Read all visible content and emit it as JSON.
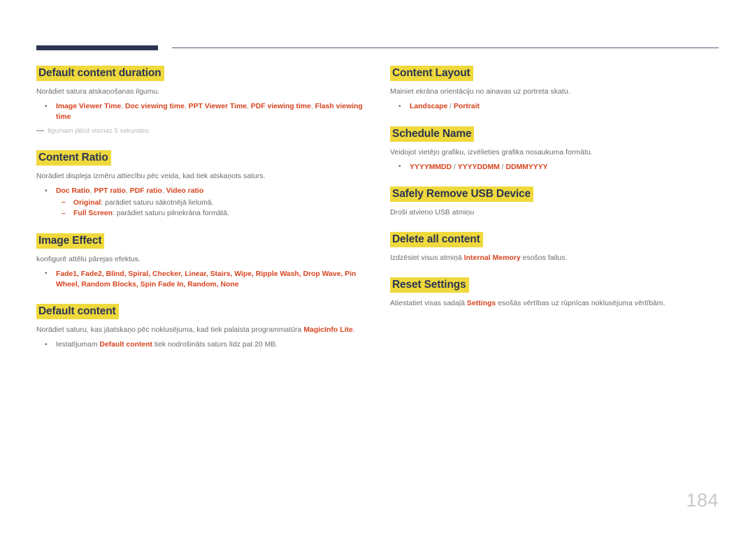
{
  "page": {
    "number": "184",
    "accent_color": "#d8431f",
    "heading_color": "#2c3553",
    "highlight_color": "#efd93c",
    "body_color": "#6b6b6b",
    "note_color": "#b9b9b9"
  },
  "left_column": {
    "sections": [
      {
        "heading": "Default content duration",
        "body": "Norādiet satura atskaņošanas ilgumu.",
        "bullet": {
          "a": "Image Viewer Time",
          "c1": ", ",
          "b": "Doc viewing time",
          "c2": ", ",
          "c": "PPT Viewer Time",
          "c3": ", ",
          "d": "PDF viewing time",
          "c4": ", ",
          "e": "Flash viewing time"
        },
        "note": "Ilgumam jābūt vismaz 5 sekundes."
      },
      {
        "heading": "Content Ratio",
        "body": "Norādiet displeja izmēru attiecību pēc veida, kad tiek atskaņots saturs.",
        "bullet": {
          "a": "Doc Ratio",
          "c1": ", ",
          "b": "PPT ratio",
          "c2": ", ",
          "c": "PDF ratio",
          "c3": ", ",
          "d": "Video ratio"
        },
        "sub": [
          {
            "term": "Original",
            "text": ": parādiet saturu sākotnējā lielumā."
          },
          {
            "term": "Full Screen",
            "text": ": parādiet saturu pilnekrāna formātā."
          }
        ]
      },
      {
        "heading": "Image Effect",
        "body": "konfigurē attēlu pārejas efektus.",
        "effects_line": "Fade1, Fade2, Blind, Spiral, Checker, Linear, Stairs, Wipe, Ripple Wash, Drop Wave, Pin Wheel, Random Blocks, Spin Fade In, Random, None"
      },
      {
        "heading": "Default content",
        "body_pre": "Norādiet saturu, kas jāatskaņo pēc noklusējuma, kad tiek palaista programmatūra ",
        "body_accent": "MagicInfo Lite",
        "body_post": ".",
        "bullet_pre": "Iestatījumam ",
        "bullet_accent": "Default content",
        "bullet_post": " tiek nodrošināts saturs līdz pat 20 MB."
      }
    ]
  },
  "right_column": {
    "sections": [
      {
        "heading": "Content Layout",
        "body": "Mainiet ekrāna orientāciju no ainavas uz portreta skatu.",
        "bullet": {
          "a": "Landscape",
          "s1": " / ",
          "b": "Portrait"
        }
      },
      {
        "heading": "Schedule Name",
        "body": "Veidojot vietējo grafiku, izvēlieties grafika nosaukuma formātu.",
        "bullet": {
          "a": "YYYYMMDD",
          "s1": " / ",
          "b": "YYYYDDMM",
          "s2": " / ",
          "c": "DDMMYYYY"
        }
      },
      {
        "heading": "Safely Remove USB Device",
        "body": "Droši atvieno USB atmiņu"
      },
      {
        "heading": "Delete all content",
        "body_pre": "Izdzēsiet visus atmiņā ",
        "body_accent": "Internal Memory",
        "body_post": " esošos failus."
      },
      {
        "heading": "Reset Settings",
        "body_pre": "Atiestatiet visas sadaļā ",
        "body_accent": "Settings",
        "body_post": " esošās vērtības uz rūpnīcas noklusējuma vērtībām."
      }
    ]
  }
}
